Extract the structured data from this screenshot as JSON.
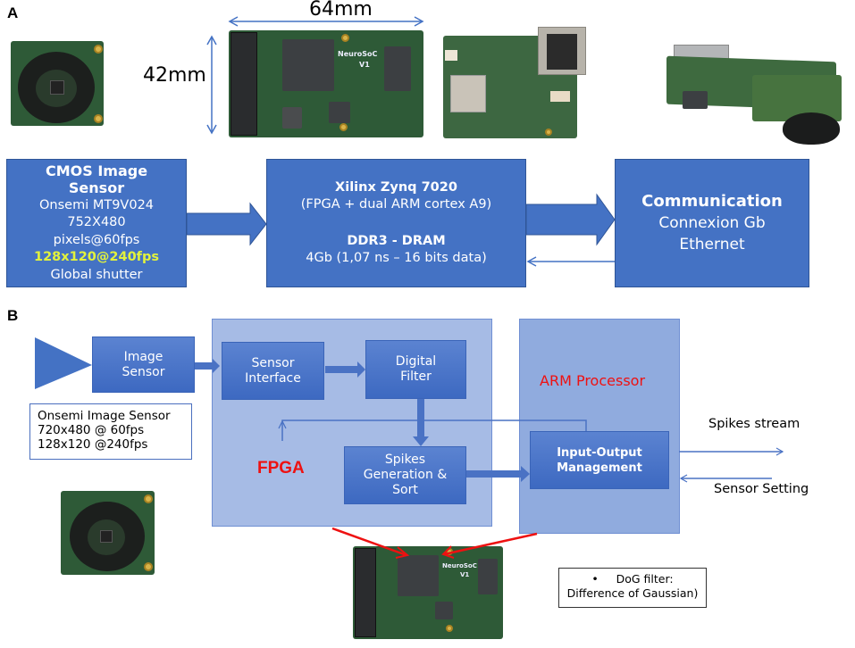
{
  "panel_a": {
    "label": "A",
    "dimension_width": "64mm",
    "dimension_height": "42mm",
    "photos": {
      "camera_module": "camera-sensor-board-photo",
      "neurosoc_board": "neurosoc-board-photo",
      "ethernet_board": "ethernet-board-photo",
      "assembled_camera": "assembled-camera-photo"
    },
    "neurosoc_silkscreen": [
      "NeuroSoC",
      "V1"
    ],
    "cmos_block": {
      "title_1": "CMOS  Image",
      "title_2": "Sensor",
      "line_1": "Onsemi MT9V024",
      "line_2": "752X480",
      "line_3": "pixels@60fps",
      "highlight": "128x120@240fps",
      "line_4": "Global shutter"
    },
    "zynq_block": {
      "title": "Xilinx Zynq 7020",
      "subtitle": "(FPGA + dual ARM  cortex A9)",
      "mem_title": "DDR3 - DRAM",
      "mem_detail": "4Gb (1,07 ns – 16 bits data)"
    },
    "comm_block": {
      "title": "Communication",
      "line_1": "Connexion Gb",
      "line_2": "Ethernet"
    }
  },
  "panel_b": {
    "label": "B",
    "image_sensor": [
      "Image",
      "Sensor"
    ],
    "sensor_note": [
      "Onsemi Image Sensor",
      "720x480 @ 60fps",
      "128x120 @240fps"
    ],
    "fpga_label": "FPGA",
    "sensor_interface": [
      "Sensor",
      "Interface"
    ],
    "digital_filter": [
      "Digital",
      "Filter"
    ],
    "spikes_generation": [
      "Spikes",
      "Generation &",
      "Sort"
    ],
    "arm_label": "ARM Processor",
    "io_management": [
      "Input-Output",
      "Management"
    ],
    "spikes_stream": "Spikes stream",
    "sensor_setting": "Sensor Setting",
    "dog_note": {
      "bullet": "•",
      "line_1": "DoG filter:",
      "line_2": "Difference of Gaussian)"
    }
  },
  "colors": {
    "block_blue": "#4472c4",
    "fpga_region": "#a6bbe5",
    "arm_region": "#90abde",
    "highlight_yellow": "#e2f23c",
    "label_red": "#ee1111"
  }
}
